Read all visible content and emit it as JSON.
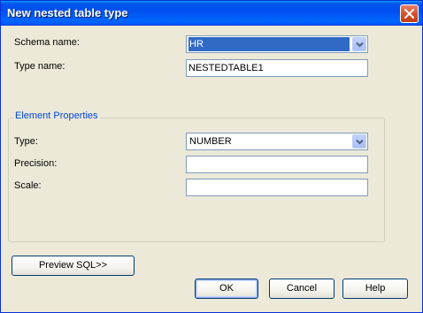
{
  "window": {
    "title": "New nested table type"
  },
  "form": {
    "schema": {
      "label": "Schema name:",
      "value": "HR"
    },
    "type_name": {
      "label": "Type name:",
      "value": "NESTEDTABLE1"
    }
  },
  "element_properties": {
    "legend": "Element Properties",
    "type": {
      "label": "Type:",
      "value": "NUMBER"
    },
    "precision": {
      "label": "Precision:",
      "value": ""
    },
    "scale": {
      "label": "Scale:",
      "value": ""
    }
  },
  "buttons": {
    "preview": "Preview SQL>>",
    "ok": "OK",
    "cancel": "Cancel",
    "help": "Help"
  },
  "icons": {
    "close": "close-icon",
    "dropdown": "chevron-down-icon"
  },
  "colors": {
    "titlebar": "#0053ee",
    "dialog_bg": "#ece9d8",
    "selection": "#316ac5",
    "group_legend": "#0046d5",
    "close_button": "#d5512b"
  }
}
